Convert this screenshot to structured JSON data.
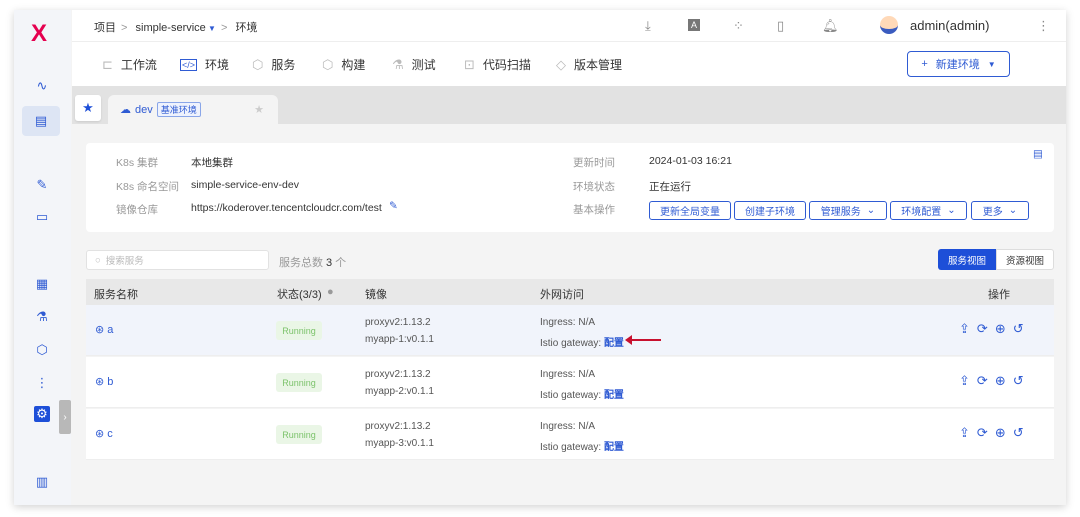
{
  "app": {
    "logo": "X"
  },
  "sidebar": {
    "items": [
      {
        "name": "monitor-icon",
        "glyph": "∿"
      },
      {
        "name": "pm-icon",
        "glyph": "▤"
      },
      {
        "name": "edit-doc-icon",
        "glyph": "✎"
      },
      {
        "name": "deploy-icon",
        "glyph": "▭"
      },
      {
        "name": "build-icon",
        "glyph": "▦"
      },
      {
        "name": "test-icon",
        "glyph": "⚗"
      },
      {
        "name": "artifact-icon",
        "glyph": "⬡"
      },
      {
        "name": "pipeline-icon",
        "glyph": "⋮"
      },
      {
        "name": "settings-icon",
        "glyph": "⚙"
      },
      {
        "name": "dashboard-icon",
        "glyph": "▥"
      }
    ],
    "collapse": "›"
  },
  "breadcrumb": {
    "root": "项目",
    "project": "simple-service",
    "current": "环境"
  },
  "header": {
    "user": "admin(admin)"
  },
  "tabs": [
    {
      "label": "工作流",
      "icon": "⊏"
    },
    {
      "label": "环境",
      "icon": "</>"
    },
    {
      "label": "服务",
      "icon": "⬡"
    },
    {
      "label": "构建",
      "icon": "⬡"
    },
    {
      "label": "测试",
      "icon": "⚗"
    },
    {
      "label": "代码扫描",
      "icon": "⊡"
    },
    {
      "label": "版本管理",
      "icon": "◇"
    }
  ],
  "new_env_button": "新建环境",
  "env_tab": {
    "name": "dev",
    "badge": "基准环境"
  },
  "info": {
    "cluster_label": "K8s 集群",
    "cluster": "本地集群",
    "namespace_label": "K8s 命名空间",
    "namespace": "simple-service-env-dev",
    "registry_label": "镜像仓库",
    "registry": "https://koderover.tencentcloudcr.com/test",
    "updated_label": "更新时间",
    "updated": "2024-01-03 16:21",
    "status_label": "环境状态",
    "status": "正在运行",
    "ops_label": "基本操作",
    "ops": [
      "更新全局变量",
      "创建子环境",
      "管理服务",
      "环境配置",
      "更多"
    ]
  },
  "search": {
    "placeholder": "搜索服务"
  },
  "count": {
    "label": "服务总数",
    "value": "3",
    "unit": "个"
  },
  "views": [
    "服务视图",
    "资源视图"
  ],
  "table": {
    "headers": [
      "服务名称",
      "状态(3/3)",
      "镜像",
      "外网访问",
      "操作"
    ],
    "rows": [
      {
        "name": "a",
        "status": "Running",
        "images": [
          "proxyv2:1.13.2",
          "myapp-1:v0.1.1"
        ],
        "ingress": "Ingress: N/A",
        "gateway": "Istio gateway:",
        "config": "配置"
      },
      {
        "name": "b",
        "status": "Running",
        "images": [
          "proxyv2:1.13.2",
          "myapp-2:v0.1.1"
        ],
        "ingress": "Ingress: N/A",
        "gateway": "Istio gateway:",
        "config": "配置"
      },
      {
        "name": "c",
        "status": "Running",
        "images": [
          "proxyv2:1.13.2",
          "myapp-3:v0.1.1"
        ],
        "ingress": "Ingress: N/A",
        "gateway": "Istio gateway:",
        "config": "配置"
      }
    ]
  }
}
